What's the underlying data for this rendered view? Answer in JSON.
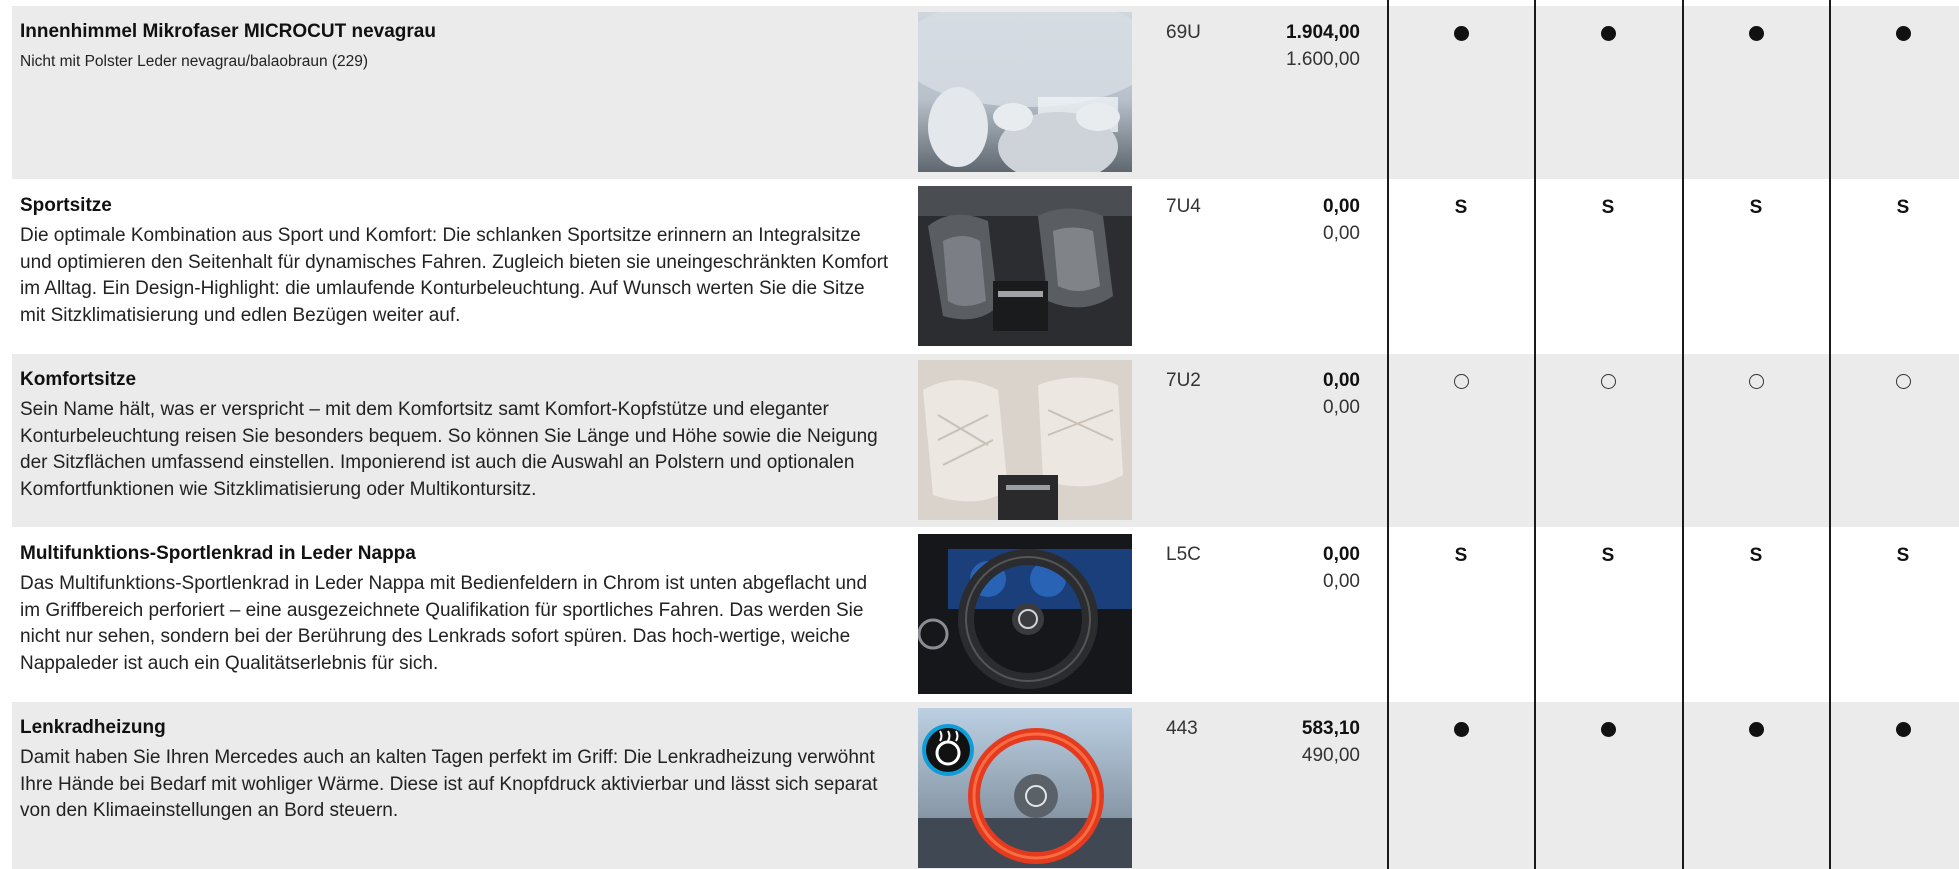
{
  "rows": [
    {
      "title": "Innenhimmel Mikrofaser MICROCUT nevagrau",
      "description": "Nicht mit Polster Leder nevagrau/balaobraun (229)",
      "image_icon": "interior-headliner-photo",
      "code": "69U",
      "price_gross": "1.904,00",
      "price_net": "1.600,00",
      "availability": [
        "standard-option",
        "standard-option",
        "standard-option",
        "standard-option"
      ]
    },
    {
      "title": "Sportsitze",
      "description": "Die optimale Kombination aus Sport und Komfort: Die schlanken Sportsitze erinnern an Integralsitze und optimieren den Seitenhalt für dynamisches Fahren. Zugleich bieten sie uneingeschränkten Komfort im Alltag. Ein Design-Highlight: die umlaufende Konturbeleuchtung. Auf Wunsch werten Sie die Sitze mit Sitzklimatisierung und edlen Bezügen weiter auf.",
      "image_icon": "sport-seats-photo",
      "code": "7U4",
      "price_gross": "0,00",
      "price_net": "0,00",
      "availability": [
        "S",
        "S",
        "S",
        "S"
      ]
    },
    {
      "title": "Komfortsitze",
      "description": "Sein Name hält, was er verspricht – mit dem Komfortsitz samt Komfort-Kopfstütze und eleganter Konturbeleuchtung reisen Sie besonders bequem. So können Sie Länge und Höhe sowie die Neigung der Sitzflächen umfassend einstellen. Imponierend ist auch die Auswahl an Polstern und optionalen Komfortfunktionen wie Sitzklimatisierung oder Multikontursitz.",
      "image_icon": "comfort-seats-photo",
      "code": "7U2",
      "price_gross": "0,00",
      "price_net": "0,00",
      "availability": [
        "optional",
        "optional",
        "optional",
        "optional"
      ]
    },
    {
      "title": "Multifunktions-Sportlenkrad in Leder Nappa",
      "description": "Das Multifunktions-Sportlenkrad in Leder Nappa mit Bedienfeldern in Chrom ist unten abgeflacht und im Griffbereich perforiert – eine ausgezeichnete Qualifikation für sportliches Fahren. Das werden Sie nicht nur sehen, sondern bei der Berührung des Lenkrads sofort spüren. Das hoch-wertige, weiche Nappaleder ist auch ein Qualitätserlebnis für sich.",
      "image_icon": "steering-wheel-photo",
      "code": "L5C",
      "price_gross": "0,00",
      "price_net": "0,00",
      "availability": [
        "S",
        "S",
        "S",
        "S"
      ]
    },
    {
      "title": "Lenkradheizung",
      "description": "Damit haben Sie Ihren Mercedes auch an kalten Tagen perfekt im Griff: Die Lenkradheizung verwöhnt Ihre Hände bei Bedarf mit wohliger Wärme. Diese ist auf Knopfdruck aktivierbar und lässt sich separat von den Klimaeinstellungen an Bord steuern.",
      "image_icon": "heated-steering-wheel-photo",
      "code": "443",
      "price_gross": "583,10",
      "price_net": "490,00",
      "availability": [
        "standard-option",
        "standard-option",
        "standard-option",
        "standard-option"
      ]
    }
  ]
}
